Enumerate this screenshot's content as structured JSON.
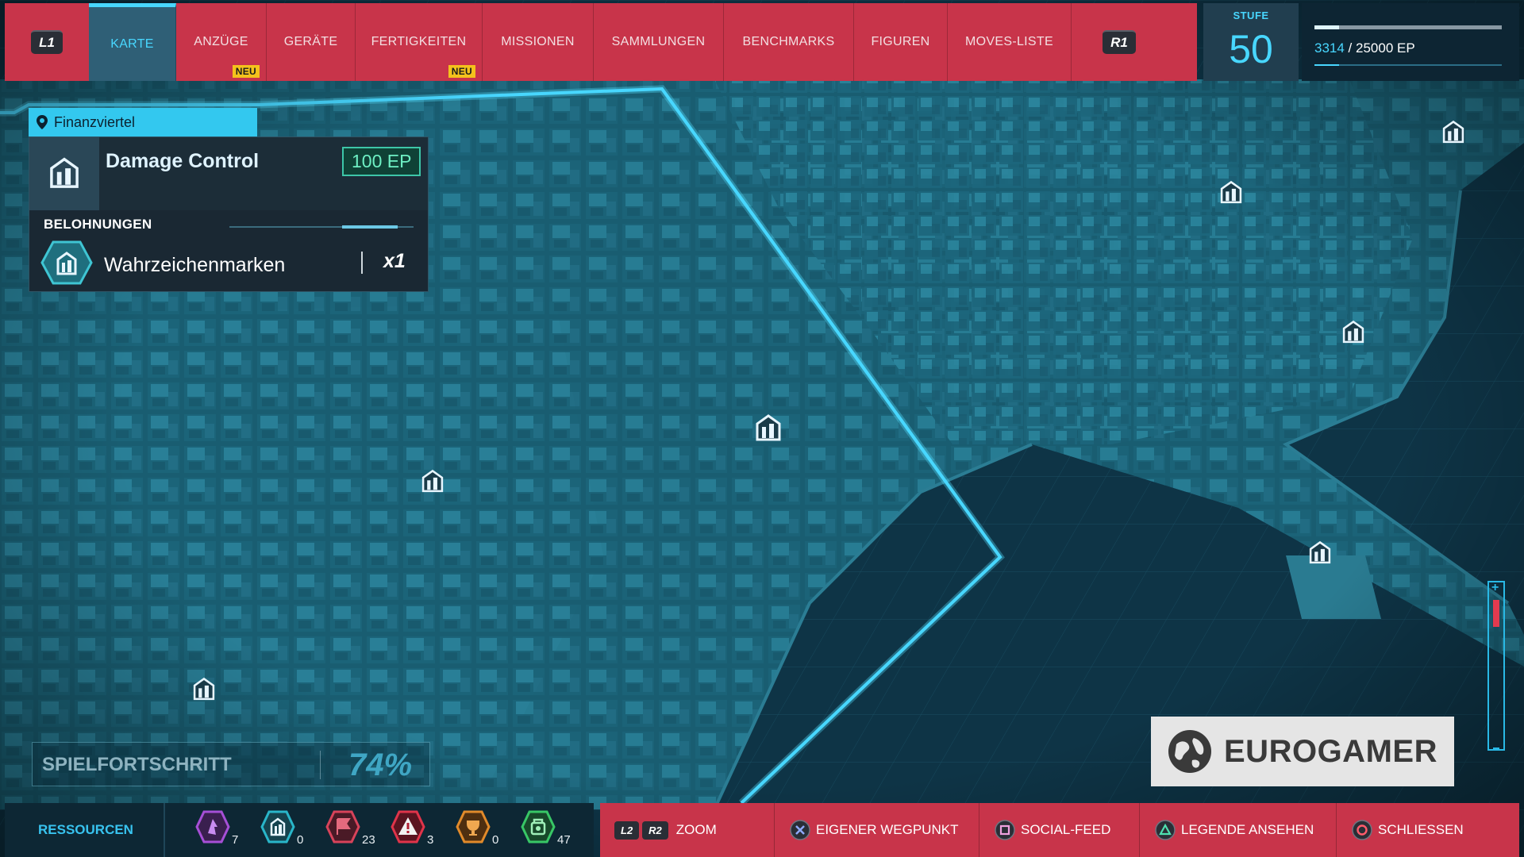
{
  "top_bar": {
    "left_trigger": "L1",
    "right_trigger": "R1",
    "tabs": [
      {
        "label": "KARTE",
        "active": true,
        "badge": ""
      },
      {
        "label": "ANZÜGE",
        "active": false,
        "badge": "NEU"
      },
      {
        "label": "GERÄTE",
        "active": false,
        "badge": ""
      },
      {
        "label": "FERTIGKEITEN",
        "active": false,
        "badge": "NEU"
      },
      {
        "label": "MISSIONEN",
        "active": false,
        "badge": ""
      },
      {
        "label": "SAMMLUNGEN",
        "active": false,
        "badge": ""
      },
      {
        "label": "BENCHMARKS",
        "active": false,
        "badge": ""
      },
      {
        "label": "FIGUREN",
        "active": false,
        "badge": ""
      },
      {
        "label": "MOVES-LISTE",
        "active": false,
        "badge": ""
      }
    ]
  },
  "level": {
    "label": "STUFE",
    "value": "50",
    "xp_current": "3314",
    "xp_total": " / 25000 EP",
    "xp_fraction": 0.1326
  },
  "info_panel": {
    "district": "Finanzviertel",
    "title": "Damage Control",
    "reward_ep": "100 EP",
    "rewards_heading": "BELOHNUNGEN",
    "reward_name": "Wahrzeichenmarken",
    "reward_quantity": "x1"
  },
  "progress": {
    "label": "SPIELFORTSCHRITT",
    "value": "74%"
  },
  "watermark": "EUROGAMER",
  "resources": {
    "label": "RESSOURCEN",
    "items": [
      {
        "icon": "research-token-icon",
        "color": "#a64fd6",
        "count": "7"
      },
      {
        "icon": "landmark-token-icon",
        "color": "#29b6c9",
        "count": "0"
      },
      {
        "icon": "backpack-token-icon",
        "color": "#d8435a",
        "count": "23"
      },
      {
        "icon": "crime-token-icon",
        "color": "#e0344a",
        "count": "3"
      },
      {
        "icon": "challenge-token-icon",
        "color": "#e18a2a",
        "count": "0"
      },
      {
        "icon": "base-token-icon",
        "color": "#38c766",
        "count": "47"
      }
    ]
  },
  "controls": [
    {
      "keys": [
        "L2",
        "R2"
      ],
      "glyph": "",
      "label": "ZOOM"
    },
    {
      "keys": [],
      "glyph": "cross-button-icon",
      "label": "EIGENER WEGPUNKT"
    },
    {
      "keys": [],
      "glyph": "square-button-icon",
      "label": "SOCIAL-FEED"
    },
    {
      "keys": [],
      "glyph": "triangle-button-icon",
      "label": "LEGENDE ANSEHEN"
    },
    {
      "keys": [],
      "glyph": "circle-button-icon",
      "label": "SCHLIESSEN"
    }
  ],
  "colors": {
    "accent": "#48d7ff",
    "menu_red": "#c8344a",
    "map_teal": "#1d6a80",
    "ep_green": "#6ef0c4"
  }
}
